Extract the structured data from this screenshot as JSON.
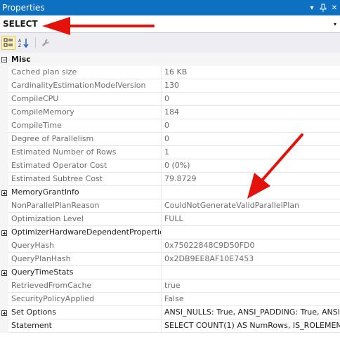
{
  "window": {
    "title": "Properties",
    "menu_glyph": "▾",
    "pin_glyph": "ㅍ",
    "close_glyph": "✕"
  },
  "object": {
    "name": "SELECT",
    "dropdown_glyph": "▾"
  },
  "toolbar": {
    "categorized_icon": "categorized-icon",
    "alphabetical_icon": "alphabetical-icon",
    "property_pages_icon": "wrench-icon"
  },
  "grid": {
    "category_misc": "Misc",
    "rows": [
      {
        "name": "Cached plan size",
        "value": "16 KB"
      },
      {
        "name": "CardinalityEstimationModelVersion",
        "value": "130"
      },
      {
        "name": "CompileCPU",
        "value": "0"
      },
      {
        "name": "CompileMemory",
        "value": "184"
      },
      {
        "name": "CompileTime",
        "value": "0"
      },
      {
        "name": "Degree of Parallelism",
        "value": "0"
      },
      {
        "name": "Estimated Number of Rows",
        "value": "1"
      },
      {
        "name": "Estimated Operator Cost",
        "value": "0 (0%)"
      },
      {
        "name": "Estimated Subtree Cost",
        "value": "79.8729"
      },
      {
        "name": "MemoryGrantInfo",
        "value": ""
      },
      {
        "name": "NonParallelPlanReason",
        "value": "CouldNotGenerateValidParallelPlan"
      },
      {
        "name": "Optimization Level",
        "value": "FULL"
      },
      {
        "name": "OptimizerHardwareDependentProperties",
        "value": ""
      },
      {
        "name": "QueryHash",
        "value": "0x75022848C9D50FD0"
      },
      {
        "name": "QueryPlanHash",
        "value": "0x2DB9EE8AF10E7453"
      },
      {
        "name": "QueryTimeStats",
        "value": ""
      },
      {
        "name": "RetrievedFromCache",
        "value": "true"
      },
      {
        "name": "SecurityPolicyApplied",
        "value": "False"
      },
      {
        "name": "Set Options",
        "value": "ANSI_NULLS: True, ANSI_PADDING: True, ANSI_"
      },
      {
        "name": "Statement",
        "value": "SELECT  COUNT(1) AS NumRows, IS_ROLEMEM"
      }
    ]
  },
  "colors": {
    "title_bar": "#0e70c0",
    "annotation_arrow": "#e3120b",
    "readonly_text": "#6d6d6d"
  }
}
